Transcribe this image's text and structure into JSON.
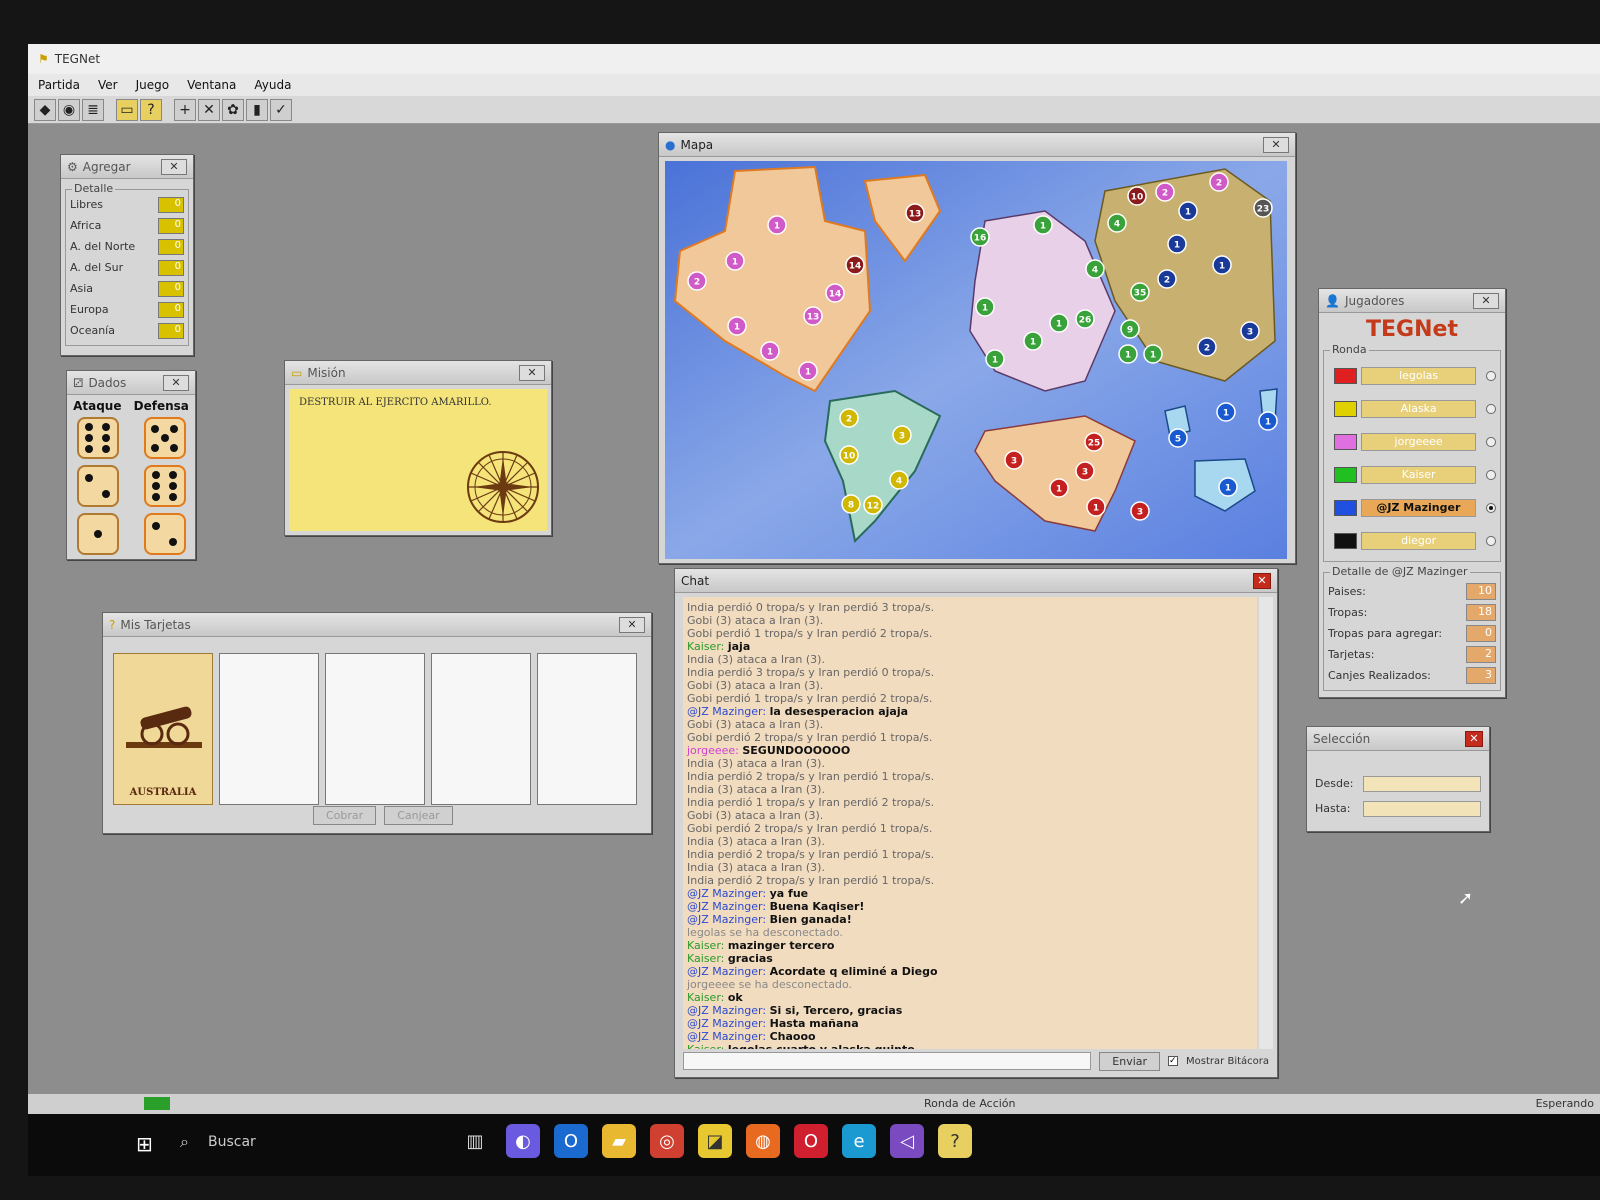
{
  "app": {
    "title": "TEGNet"
  },
  "menu": [
    "Partida",
    "Ver",
    "Juego",
    "Ventana",
    "Ayuda"
  ],
  "toolbar": [
    "◆",
    "◉",
    "≣",
    "▭",
    "?",
    "+",
    "✕",
    "✿",
    "▮",
    "✓"
  ],
  "agregar": {
    "title": "Agregar",
    "group": "Detalle",
    "rows": [
      {
        "label": "Libres",
        "value": "0"
      },
      {
        "label": "Africa",
        "value": "0"
      },
      {
        "label": "A. del Norte",
        "value": "0"
      },
      {
        "label": "A. del Sur",
        "value": "0"
      },
      {
        "label": "Asia",
        "value": "0"
      },
      {
        "label": "Europa",
        "value": "0"
      },
      {
        "label": "Oceanía",
        "value": "0"
      }
    ]
  },
  "dados": {
    "title": "Dados",
    "ataque_label": "Ataque",
    "defensa_label": "Defensa",
    "ataque": [
      6,
      2,
      1
    ],
    "defensa": [
      5,
      6,
      2
    ]
  },
  "mision": {
    "title": "Misión",
    "text": "DESTRUIR AL EJERCITO AMARILLO."
  },
  "tarjetas": {
    "title": "Mis Tarjetas",
    "card_label": "AUSTRALIA",
    "cobrar": "Cobrar",
    "canjear": "Canjear"
  },
  "mapa": {
    "title": "Mapa",
    "armies": [
      {
        "color": "#d05ac8",
        "n": "1"
      },
      {
        "color": "#d05ac8",
        "n": "2"
      },
      {
        "color": "#d05ac8",
        "n": "1"
      },
      {
        "color": "#d05ac8",
        "n": "1"
      },
      {
        "color": "#d05ac8",
        "n": "1"
      },
      {
        "color": "#d05ac8",
        "n": "13"
      },
      {
        "color": "#d05ac8",
        "n": "14"
      },
      {
        "color": "#d05ac8",
        "n": "1"
      },
      {
        "color": "#8b1a1a",
        "n": "13"
      },
      {
        "color": "#8b1a1a",
        "n": "14"
      },
      {
        "color": "#3aa23a",
        "n": "16"
      },
      {
        "color": "#3aa23a",
        "n": "1"
      },
      {
        "color": "#3aa23a",
        "n": "1"
      },
      {
        "color": "#3aa23a",
        "n": "1"
      },
      {
        "color": "#3aa23a",
        "n": "1"
      },
      {
        "color": "#3aa23a",
        "n": "1"
      },
      {
        "color": "#3aa23a",
        "n": "26"
      },
      {
        "color": "#3aa23a",
        "n": "4"
      },
      {
        "color": "#3aa23a",
        "n": "4"
      },
      {
        "color": "#3aa23a",
        "n": "9"
      },
      {
        "color": "#3aa23a",
        "n": "1"
      },
      {
        "color": "#3aa23a",
        "n": "1"
      },
      {
        "color": "#3aa23a",
        "n": "35"
      },
      {
        "color": "#8b1a1a",
        "n": "10"
      },
      {
        "color": "#d05ac8",
        "n": "2"
      },
      {
        "color": "#d05ac8",
        "n": "2"
      },
      {
        "color": "#1a3a9a",
        "n": "1"
      },
      {
        "color": "#1a3a9a",
        "n": "1"
      },
      {
        "color": "#1a3a9a",
        "n": "2"
      },
      {
        "color": "#1a3a9a",
        "n": "1"
      },
      {
        "color": "#1a3a9a",
        "n": "3"
      },
      {
        "color": "#1a3a9a",
        "n": "2"
      },
      {
        "color": "#555",
        "n": "23"
      },
      {
        "color": "#d0b800",
        "n": "2"
      },
      {
        "color": "#d0b800",
        "n": "3"
      },
      {
        "color": "#d0b800",
        "n": "10"
      },
      {
        "color": "#d0b800",
        "n": "4"
      },
      {
        "color": "#d0b800",
        "n": "8"
      },
      {
        "color": "#d0b800",
        "n": "12"
      },
      {
        "color": "#c42020",
        "n": "3"
      },
      {
        "color": "#c42020",
        "n": "25"
      },
      {
        "color": "#c42020",
        "n": "3"
      },
      {
        "color": "#c42020",
        "n": "1"
      },
      {
        "color": "#c42020",
        "n": "1"
      },
      {
        "color": "#c42020",
        "n": "3"
      },
      {
        "color": "#1a5ad0",
        "n": "5"
      },
      {
        "color": "#1a5ad0",
        "n": "1"
      },
      {
        "color": "#1a5ad0",
        "n": "1"
      },
      {
        "color": "#1a5ad0",
        "n": "1"
      }
    ]
  },
  "chat": {
    "title": "Chat",
    "lines": [
      {
        "who": "",
        "color": "#666",
        "text": "India perdió 0 tropa/s y Iran perdió 3 tropa/s."
      },
      {
        "who": "",
        "color": "#666",
        "text": "Gobi (3) ataca a Iran (3)."
      },
      {
        "who": "",
        "color": "#666",
        "text": "Gobi perdió 1 tropa/s y Iran perdió 2 tropa/s."
      },
      {
        "who": "Kaiser:",
        "color": "#2a9a2a",
        "text": "jaja"
      },
      {
        "who": "",
        "color": "#666",
        "text": "India (3) ataca a Iran (3)."
      },
      {
        "who": "",
        "color": "#666",
        "text": "India perdió 3 tropa/s y Iran perdió 0 tropa/s."
      },
      {
        "who": "",
        "color": "#666",
        "text": "Gobi (3) ataca a Iran (3)."
      },
      {
        "who": "",
        "color": "#666",
        "text": "Gobi perdió 1 tropa/s y Iran perdió 2 tropa/s."
      },
      {
        "who": "@JZ Mazinger:",
        "color": "#2a4ad0",
        "text": "la desesperacion ajaja"
      },
      {
        "who": "",
        "color": "#666",
        "text": "Gobi (3) ataca a Iran (3)."
      },
      {
        "who": "",
        "color": "#666",
        "text": "Gobi perdió 2 tropa/s y Iran perdió 1 tropa/s."
      },
      {
        "who": "jorgeeee:",
        "color": "#d040d0",
        "text": "SEGUNDOOOOOO"
      },
      {
        "who": "",
        "color": "#666",
        "text": "India (3) ataca a Iran (3)."
      },
      {
        "who": "",
        "color": "#666",
        "text": "India perdió 2 tropa/s y Iran perdió 1 tropa/s."
      },
      {
        "who": "",
        "color": "#666",
        "text": "India (3) ataca a Iran (3)."
      },
      {
        "who": "",
        "color": "#666",
        "text": "India perdió 1 tropa/s y Iran perdió 2 tropa/s."
      },
      {
        "who": "",
        "color": "#666",
        "text": "Gobi (3) ataca a Iran (3)."
      },
      {
        "who": "",
        "color": "#666",
        "text": "Gobi perdió 2 tropa/s y Iran perdió 1 tropa/s."
      },
      {
        "who": "",
        "color": "#666",
        "text": "India (3) ataca a Iran (3)."
      },
      {
        "who": "",
        "color": "#666",
        "text": "India perdió 2 tropa/s y Iran perdió 1 tropa/s."
      },
      {
        "who": "",
        "color": "#666",
        "text": "India (3) ataca a Iran (3)."
      },
      {
        "who": "",
        "color": "#666",
        "text": "India perdió 2 tropa/s y Iran perdió 1 tropa/s."
      },
      {
        "who": "@JZ Mazinger:",
        "color": "#2a4ad0",
        "text": "ya fue"
      },
      {
        "who": "@JZ Mazinger:",
        "color": "#2a4ad0",
        "text": "Buena Kaqiser!"
      },
      {
        "who": "@JZ Mazinger:",
        "color": "#2a4ad0",
        "text": "Bien ganada!"
      },
      {
        "who": "",
        "color": "#888",
        "text": "legolas se ha desconectado."
      },
      {
        "who": "Kaiser:",
        "color": "#2a9a2a",
        "text": "mazinger tercero"
      },
      {
        "who": "Kaiser:",
        "color": "#2a9a2a",
        "text": "gracias"
      },
      {
        "who": "@JZ Mazinger:",
        "color": "#2a4ad0",
        "text": "Acordate q eliminé a Diego"
      },
      {
        "who": "",
        "color": "#888",
        "text": "jorgeeee se ha desconectado."
      },
      {
        "who": "Kaiser:",
        "color": "#2a9a2a",
        "text": "ok"
      },
      {
        "who": "@JZ Mazinger:",
        "color": "#2a4ad0",
        "text": "Si si, Tercero, gracias"
      },
      {
        "who": "@JZ Mazinger:",
        "color": "#2a4ad0",
        "text": "Hasta mañana"
      },
      {
        "who": "@JZ Mazinger:",
        "color": "#2a4ad0",
        "text": "Chaooo"
      },
      {
        "who": "Kaiser:",
        "color": "#2a9a2a",
        "text": "legolas cuarto y alaska quinto"
      }
    ],
    "send_label": "Enviar",
    "log_label": "Mostrar Bitácora"
  },
  "jugadores": {
    "title": "Jugadores",
    "brand": "TEGNet",
    "ronda_label": "Ronda",
    "players": [
      {
        "name": "legolas",
        "color": "#e02020",
        "active": false
      },
      {
        "name": "Alaska",
        "color": "#e0d000",
        "active": false
      },
      {
        "name": "jorgeeee",
        "color": "#e070e0",
        "active": false
      },
      {
        "name": "Kaiser",
        "color": "#20c020",
        "active": false
      },
      {
        "name": "@JZ Mazinger",
        "color": "#2050e0",
        "active": true
      },
      {
        "name": "diegor",
        "color": "#111111",
        "active": false
      }
    ],
    "detalle_label": "Detalle de @JZ Mazinger",
    "detalle": [
      {
        "label": "Paises:",
        "value": "10"
      },
      {
        "label": "Tropas:",
        "value": "18"
      },
      {
        "label": "Tropas para agregar:",
        "value": "0"
      },
      {
        "label": "Tarjetas:",
        "value": "2"
      },
      {
        "label": "Canjes Realizados:",
        "value": "3"
      }
    ]
  },
  "seleccion": {
    "title": "Selección",
    "desde": "Desde:",
    "hasta": "Hasta:"
  },
  "status": {
    "center": "Ronda de Acción",
    "right": "Esperando"
  },
  "taskbar": {
    "search": "Buscar"
  }
}
